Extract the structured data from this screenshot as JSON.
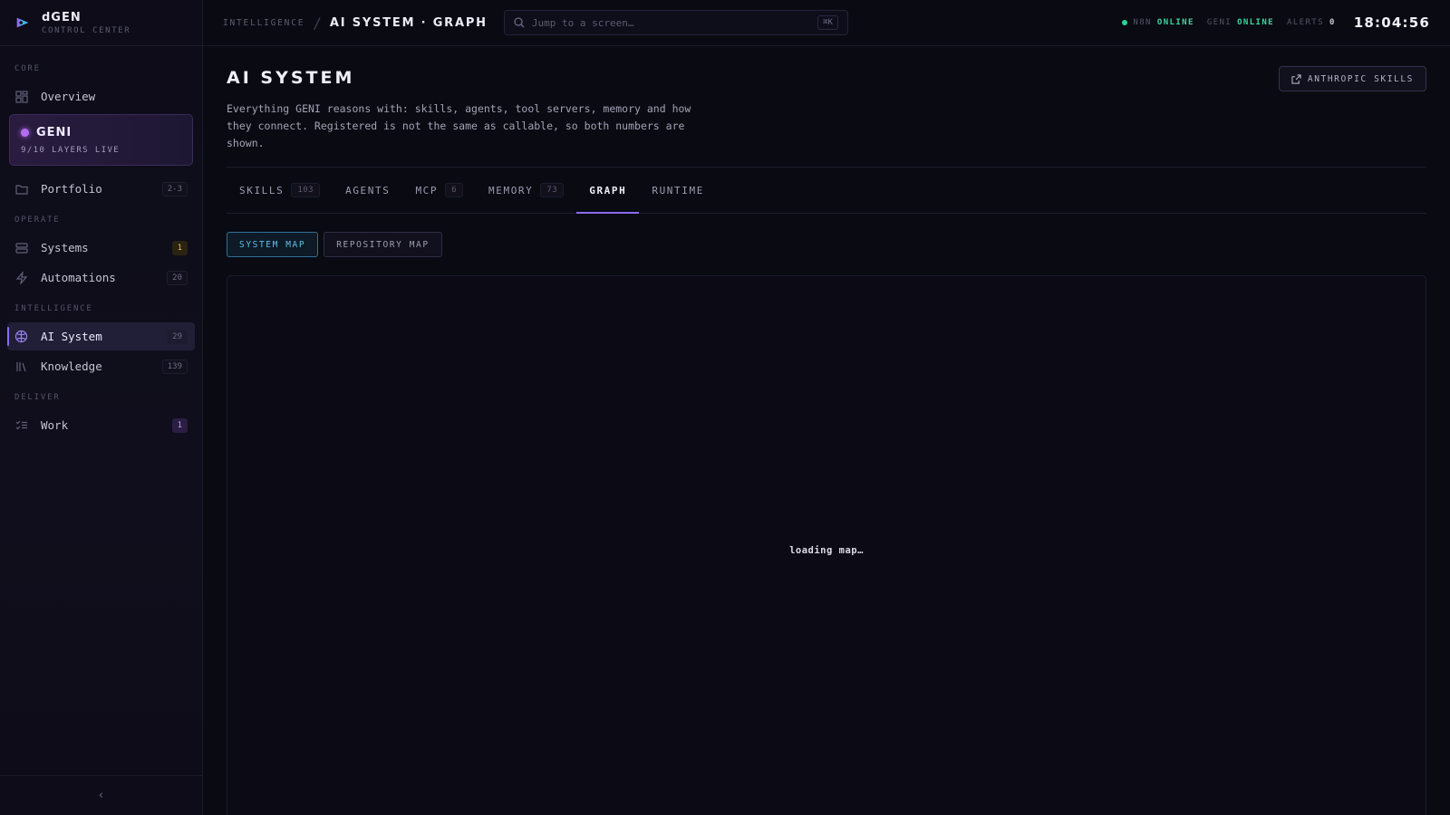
{
  "brand": {
    "name": "dGEN",
    "subtitle": "CONTROL CENTER"
  },
  "sidebar": {
    "sections": {
      "core": "CORE",
      "operate": "OPERATE",
      "intelligence": "INTELLIGENCE",
      "deliver": "DELIVER"
    },
    "overview": {
      "label": "Overview"
    },
    "geni": {
      "label": "GENI",
      "status": "9/10 LAYERS LIVE"
    },
    "portfolio": {
      "label": "Portfolio",
      "badge": "2-3"
    },
    "systems": {
      "label": "Systems",
      "badge": "1"
    },
    "automations": {
      "label": "Automations",
      "badge": "20"
    },
    "ai_system": {
      "label": "AI System",
      "badge": "29"
    },
    "knowledge": {
      "label": "Knowledge",
      "badge": "139"
    },
    "work": {
      "label": "Work",
      "badge": "1"
    },
    "collapse_glyph": "‹"
  },
  "topbar": {
    "breadcrumb_parent": "INTELLIGENCE",
    "breadcrumb_sep": "/",
    "breadcrumb_current": "AI SYSTEM · GRAPH",
    "search_placeholder": "Jump to a screen…",
    "search_shortcut": "⌘K",
    "status": {
      "n8n_key": "N8N",
      "n8n_value": "ONLINE",
      "geni_key": "GENI",
      "geni_value": "ONLINE",
      "alerts_key": "ALERTS",
      "alerts_value": "0"
    },
    "clock": "18:04:56"
  },
  "page": {
    "title": "AI SYSTEM",
    "description": "Everything GENI reasons with: skills, agents, tool servers, memory and how they connect. Registered is not the same as callable, so both numbers are shown.",
    "external_button": "ANTHROPIC SKILLS"
  },
  "tabs": [
    {
      "label": "SKILLS",
      "count": "103"
    },
    {
      "label": "AGENTS"
    },
    {
      "label": "MCP",
      "count": "6"
    },
    {
      "label": "MEMORY",
      "count": "73"
    },
    {
      "label": "GRAPH"
    },
    {
      "label": "RUNTIME"
    }
  ],
  "subtabs": {
    "system_map": "SYSTEM MAP",
    "repository_map": "REPOSITORY MAP"
  },
  "map": {
    "loading_text": "loading map…"
  },
  "colors": {
    "accent": "#8a6cf0",
    "online": "#3ed6a0",
    "subtab_active": "#5fc0ea",
    "geni_dot": "#b56cf0"
  }
}
